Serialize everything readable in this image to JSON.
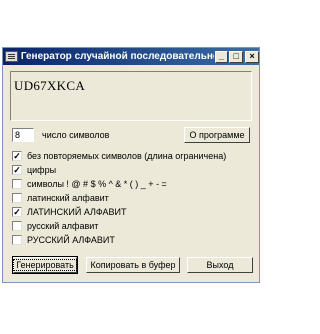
{
  "window": {
    "title": "Генератор случайной последовательности",
    "minimize": "_",
    "maximize": "□",
    "close": "×"
  },
  "output": {
    "value": "UD67XKCA"
  },
  "length": {
    "value": "8",
    "label": "число символов"
  },
  "buttons": {
    "about": "О программе",
    "generate": "Генерировать",
    "copy": "Копировать в буфер",
    "exit": "Выход"
  },
  "options": [
    {
      "label": "без повторяемых символов (длина ограничена)",
      "checked": true
    },
    {
      "label": "цифры",
      "checked": true
    },
    {
      "label": "символы ! @ # $ % ^ & * ( ) _ + - =",
      "checked": false
    },
    {
      "label": "латинский алфавит",
      "checked": false
    },
    {
      "label": "ЛАТИНСКИЙ АЛФАВИТ",
      "checked": true
    },
    {
      "label": "русский алфавит",
      "checked": false
    },
    {
      "label": "РУССКИЙ АЛФАВИТ",
      "checked": false
    }
  ]
}
